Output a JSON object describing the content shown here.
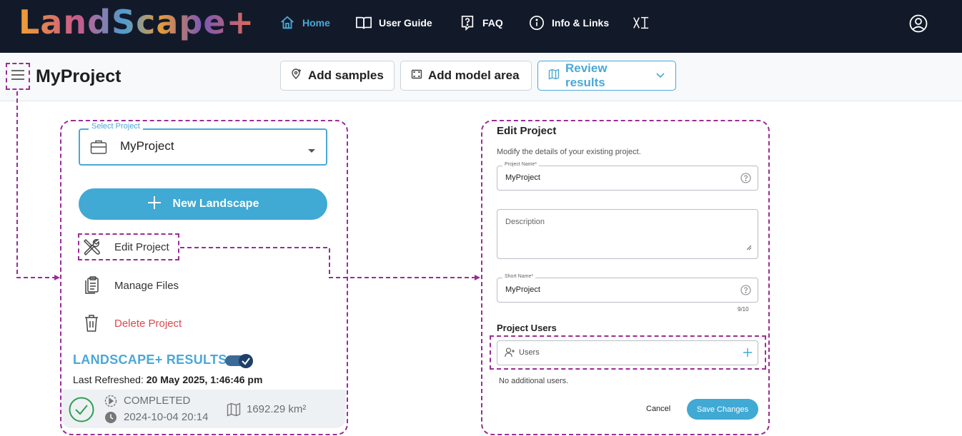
{
  "app": {
    "logo": "LandScape+"
  },
  "nav": {
    "home": "Home",
    "user_guide": "User Guide",
    "faq": "FAQ",
    "info_links": "Info & Links"
  },
  "header": {
    "project_title": "MyProject"
  },
  "toolbar": {
    "add_samples": "Add samples",
    "add_model_area": "Add model area",
    "review_results": "Review results"
  },
  "sidebar": {
    "select_label": "Select Project",
    "selected_project": "MyProject",
    "new_landscape": "New Landscape",
    "edit_project": "Edit Project",
    "manage_files": "Manage Files",
    "delete_project": "Delete Project",
    "results_title": "LANDSCAPE+ RESULTS",
    "results_toggle_on": true,
    "last_refreshed_label": "Last Refreshed:",
    "last_refreshed_value": "20 May 2025, 1:46:46 pm",
    "status": "COMPLETED",
    "status_date": "2024-10-04 20:14",
    "area": "1692.29 km²"
  },
  "edit_panel": {
    "title": "Edit Project",
    "subtitle": "Modify the details of your existing project.",
    "project_name_label": "Project Name*",
    "project_name_value": "MyProject",
    "description_placeholder": "Description",
    "short_name_label": "Short Name*",
    "short_name_value": "MyProject",
    "short_name_counter": "9/10",
    "users_section": "Project Users",
    "users_placeholder": "Users",
    "no_users": "No additional users.",
    "cancel": "Cancel",
    "save": "Save Changes"
  },
  "colors": {
    "accent": "#40a9d4",
    "nav_bg": "#121a2a",
    "highlight": "#9b2c96",
    "danger": "#e0474c",
    "success": "#2e9e4f"
  }
}
